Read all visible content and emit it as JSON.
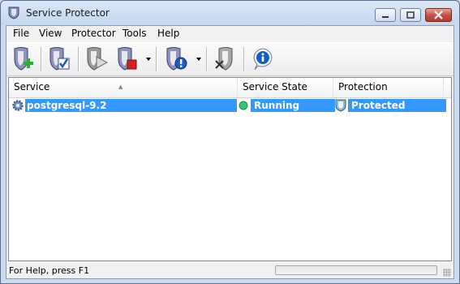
{
  "window": {
    "title": "Service Protector"
  },
  "menu": [
    "File",
    "View",
    "Protector",
    "Tools",
    "Help"
  ],
  "toolbar": {
    "buttons": [
      {
        "name": "add-service-icon"
      },
      {
        "name": "check-service-icon"
      },
      {
        "name": "start-service-icon"
      },
      {
        "name": "stop-service-icon",
        "dropdown": true
      },
      {
        "name": "alert-settings-icon",
        "dropdown": true
      },
      {
        "name": "remove-service-icon"
      },
      {
        "name": "about-info-icon"
      }
    ]
  },
  "list": {
    "columns": [
      "Service",
      "Service State",
      "Protection"
    ],
    "rows": [
      {
        "service": "postgresql-9.2",
        "state": "Running",
        "protection": "Protected",
        "state_color": "#34c47c",
        "selected": true
      }
    ]
  },
  "status": {
    "text": "For Help, press F1"
  },
  "colors": {
    "selection": "#3399ff",
    "stop": "#d81f1f",
    "add": "#2fae2f",
    "info": "#1560bd"
  }
}
